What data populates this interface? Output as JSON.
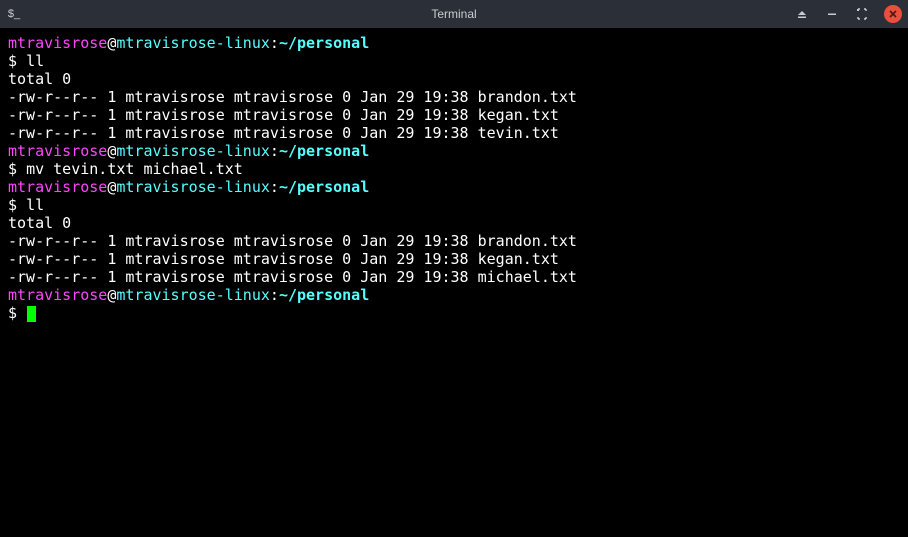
{
  "window": {
    "title": "Terminal",
    "app_icon_glyph": "$_"
  },
  "colors": {
    "user": "#ff44ff",
    "host": "#55ffff",
    "path": "#55ffff",
    "close": "#e84f3d",
    "cursor": "#00ff00"
  },
  "prompt": {
    "user": "mtravisrose",
    "at": "@",
    "host": "mtravisrose-linux",
    "sep": ":",
    "path": "~/personal",
    "dollar": "$ "
  },
  "lines": [
    {
      "type": "prompt"
    },
    {
      "type": "cmd",
      "text": "ll"
    },
    {
      "type": "out",
      "text": "total 0"
    },
    {
      "type": "out",
      "text": "-rw-r--r-- 1 mtravisrose mtravisrose 0 Jan 29 19:38 brandon.txt"
    },
    {
      "type": "out",
      "text": "-rw-r--r-- 1 mtravisrose mtravisrose 0 Jan 29 19:38 kegan.txt"
    },
    {
      "type": "out",
      "text": "-rw-r--r-- 1 mtravisrose mtravisrose 0 Jan 29 19:38 tevin.txt"
    },
    {
      "type": "prompt"
    },
    {
      "type": "cmd",
      "text": "mv tevin.txt michael.txt"
    },
    {
      "type": "prompt"
    },
    {
      "type": "cmd",
      "text": "ll"
    },
    {
      "type": "out",
      "text": "total 0"
    },
    {
      "type": "out",
      "text": "-rw-r--r-- 1 mtravisrose mtravisrose 0 Jan 29 19:38 brandon.txt"
    },
    {
      "type": "out",
      "text": "-rw-r--r-- 1 mtravisrose mtravisrose 0 Jan 29 19:38 kegan.txt"
    },
    {
      "type": "out",
      "text": "-rw-r--r-- 1 mtravisrose mtravisrose 0 Jan 29 19:38 michael.txt"
    },
    {
      "type": "prompt"
    },
    {
      "type": "cursor"
    }
  ]
}
